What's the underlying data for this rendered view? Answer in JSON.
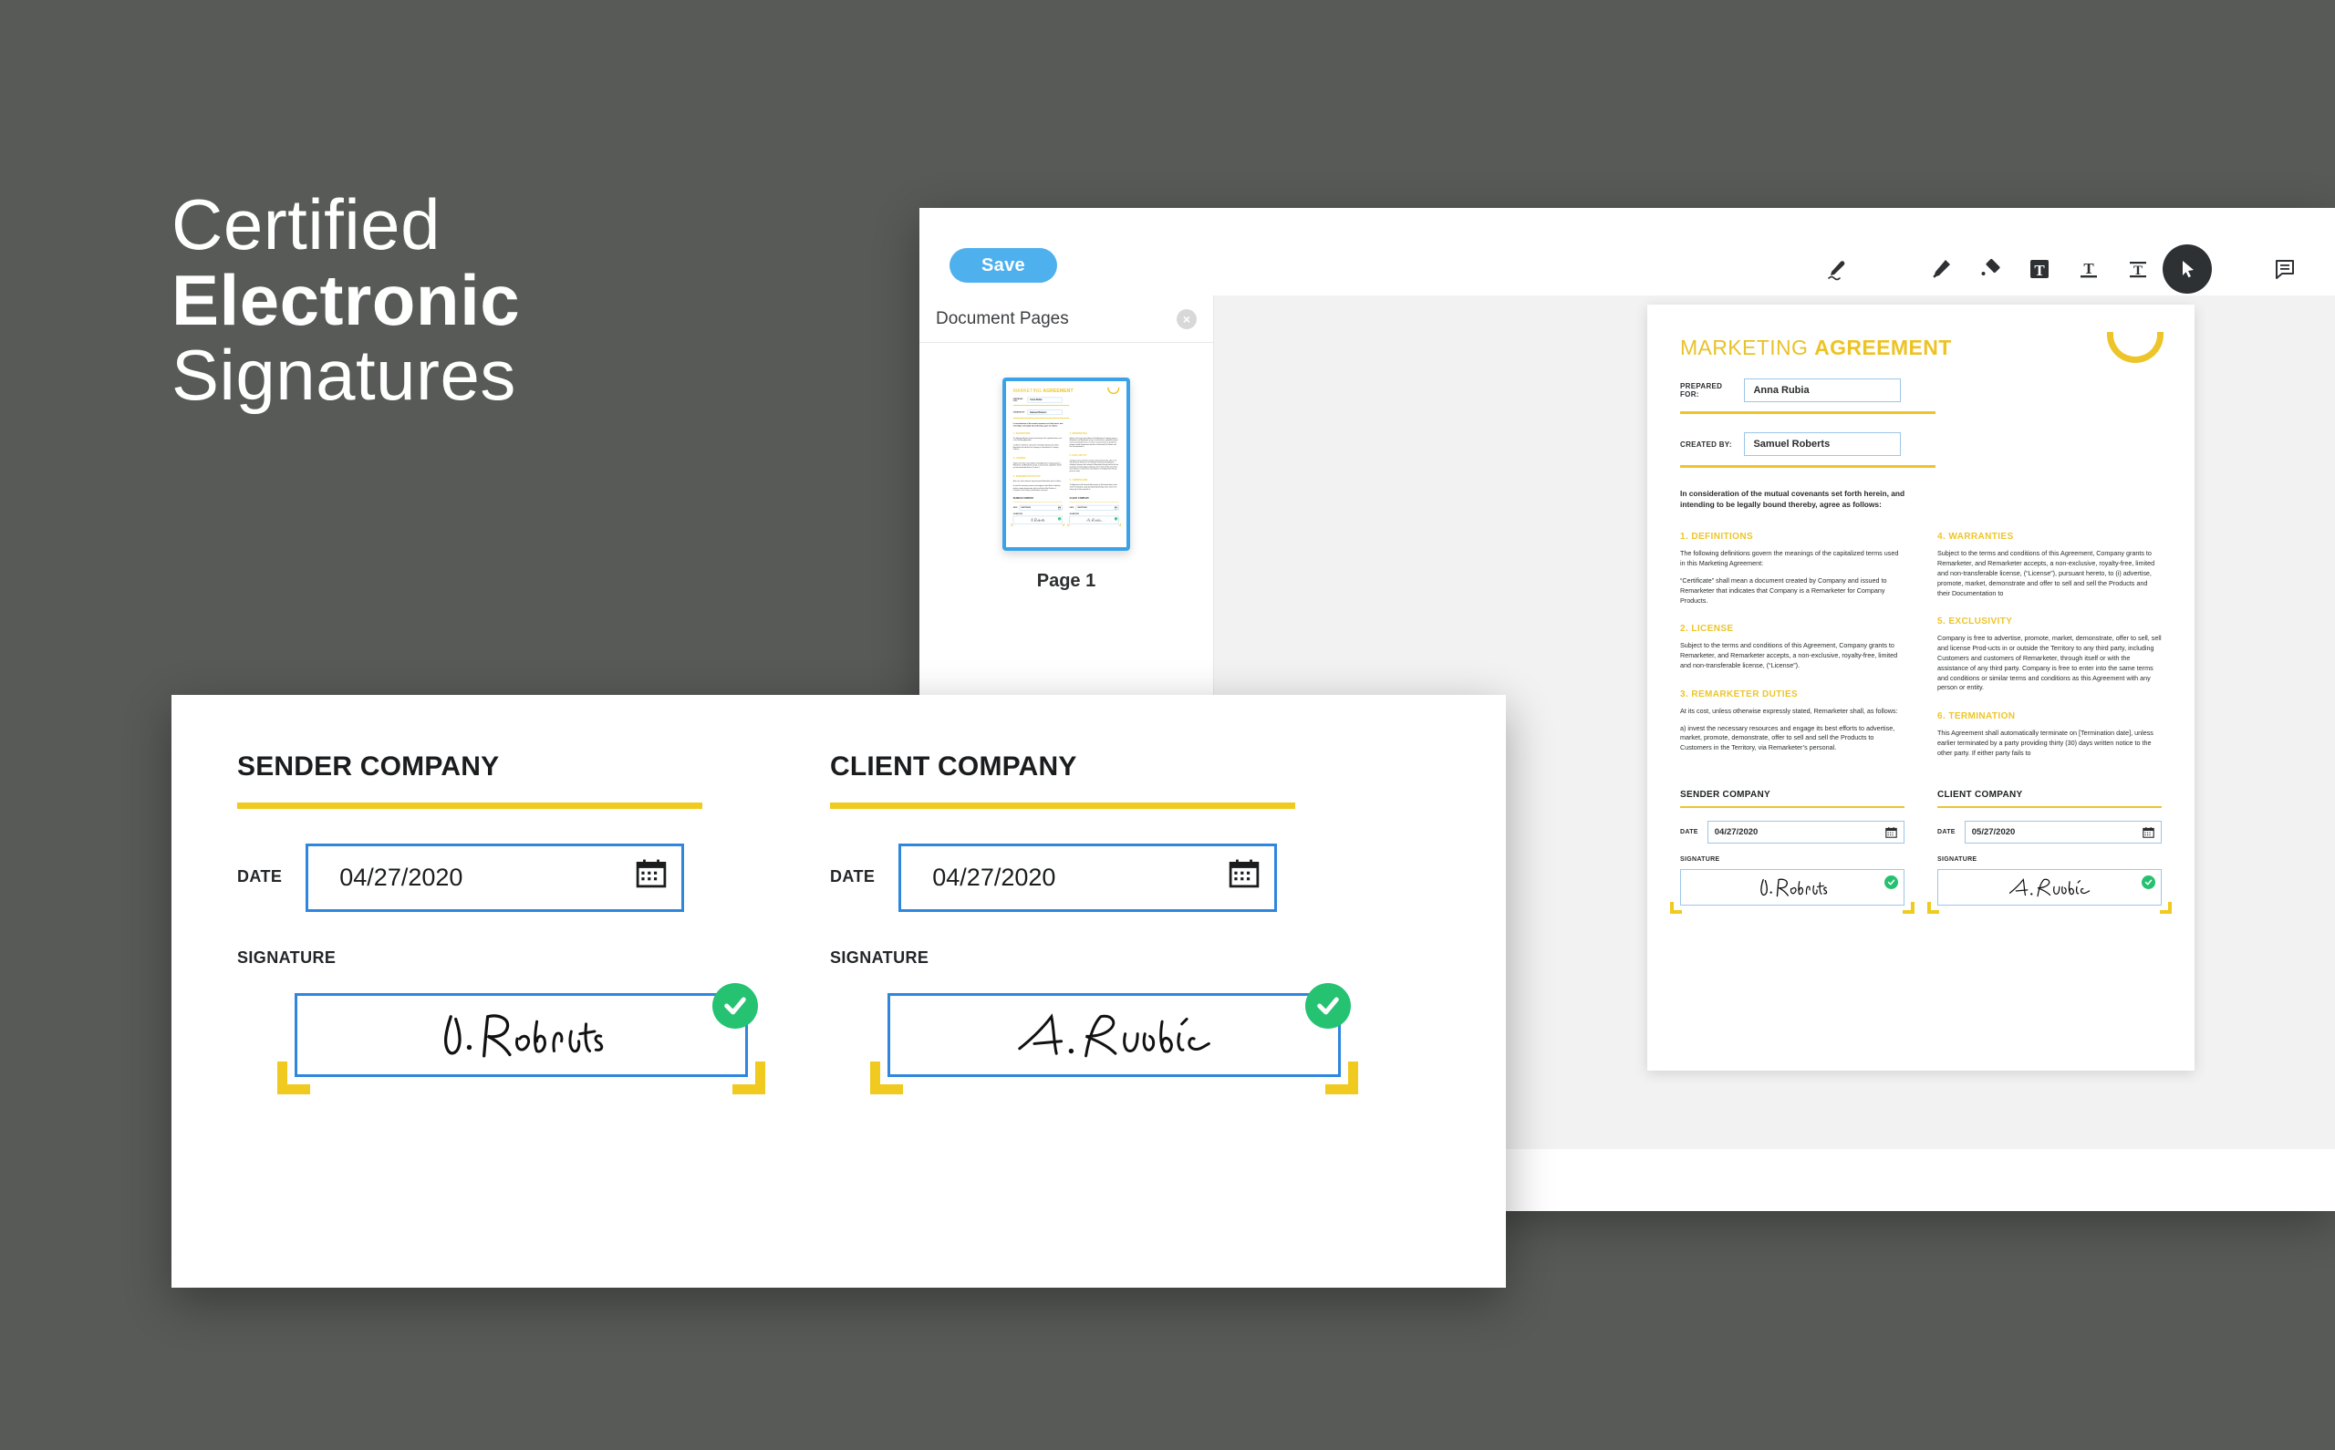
{
  "headline": {
    "line1": "Certified",
    "line2": "Electronic",
    "line3": "Signatures"
  },
  "colors": {
    "background": "#575a57",
    "accent_yellow": "#edc52a",
    "accent_blue": "#2e86de",
    "save_blue": "#4fb0ee",
    "check_green": "#24c271",
    "field_border_blue": "#9cc6e8"
  },
  "toolbar": {
    "save_label": "Save",
    "tools": [
      {
        "name": "signature-pen-icon",
        "label": "Signature",
        "active": false
      },
      {
        "name": "highlighter-icon",
        "label": "Highlight",
        "active": false
      },
      {
        "name": "eraser-icon",
        "label": "Erase",
        "active": false
      },
      {
        "name": "text-box-icon",
        "label": "Text Box",
        "active": false
      },
      {
        "name": "text-underline-icon",
        "label": "Underline Text",
        "active": false
      },
      {
        "name": "text-strikethrough-icon",
        "label": "Strikethrough Text",
        "active": false
      },
      {
        "name": "select-cursor-icon",
        "label": "Select",
        "active": true
      },
      {
        "name": "comment-icon",
        "label": "Comment",
        "active": false
      }
    ]
  },
  "sidebar": {
    "title": "Document Pages",
    "close_label": "×",
    "pages": [
      {
        "label": "Page 1",
        "selected": true
      }
    ]
  },
  "document": {
    "title_light": "MARKETING ",
    "title_bold": "AGREEMENT",
    "fields": [
      {
        "label": "PREPARED FOR:",
        "value": "Anna Rubia"
      },
      {
        "label": "CREATED BY:",
        "value": "Samuel Roberts"
      }
    ],
    "intro": "In consideration of the mutual covenants set forth herein, and intending to be legally bound thereby, agree as follows:",
    "left_sections": [
      {
        "heading": "1. DEFINITIONS",
        "paragraphs": [
          "The following definitions govern the meanings of the capitalized terms used in this Marketing Agreement:",
          "“Certificate” shall mean a document created by Company and issued to Remarketer that indicates that Company is a Remarketer for Company Products."
        ]
      },
      {
        "heading": "2. LICENSE",
        "paragraphs": [
          "Subject to the terms and conditions of this Agreement, Company grants to Remarketer, and Remarketer accepts, a non-exclusive, royalty-free, limited and non-transferable license, (“License”)."
        ]
      },
      {
        "heading": "3. REMARKETER DUTIES",
        "paragraphs": [
          "At its cost, unless otherwise expressly stated, Remarketer shall, as follows:",
          "a) invest the necessary resources and engage its best efforts to advertise, market, promote, demonstrate, offer to sell and sell the Products to Customers in the Territory, via Remarketer’s personal."
        ]
      }
    ],
    "right_sections": [
      {
        "heading": "4. WARRANTIES",
        "paragraphs": [
          "Subject to the terms and conditions of this Agreement, Company grants to Remarketer, and Remarketer accepts, a non-exclusive, royalty-free, limited and non-transferable license, (“License”), pursuant hereto, to (i) advertise, promote, market, demonstrate and offer to sell and sell the Products and their Documentation to"
        ]
      },
      {
        "heading": "5. EXCLUSIVITY",
        "paragraphs": [
          "Company is free to advertise, promote, market, demonstrate, offer to sell, sell and license Prod-ucts in or outside the Territory to any third party, including Customers and customers of Remarketer, through itself or with the assistance of any third party. Company is free to enter into the same terms and conditions or similar terms and conditions as this Agreement with any person or entity."
        ]
      },
      {
        "heading": "6. TERMINATION",
        "paragraphs": [
          "This Agreement shall automatically terminate on [Termination date], unless earlier terminated by a party providing thirty (30) days written notice to the other party. If either party fails to"
        ]
      }
    ],
    "signature_blocks": [
      {
        "company": "SENDER COMPANY",
        "date_label": "DATE",
        "date_value": "04/27/2020",
        "signature_label": "SIGNATURE",
        "signature_name": "J. Roberts",
        "verified": true
      },
      {
        "company": "CLIENT COMPANY",
        "date_label": "DATE",
        "date_value": "05/27/2020",
        "signature_label": "SIGNATURE",
        "signature_name": "A. Rubia",
        "verified": true
      }
    ]
  },
  "foreground_card": {
    "blocks": [
      {
        "company": "SENDER COMPANY",
        "date_label": "DATE",
        "date_value": "04/27/2020",
        "signature_label": "SIGNATURE",
        "signature_name": "J. Roberts",
        "verified": true
      },
      {
        "company": "CLIENT COMPANY",
        "date_label": "DATE",
        "date_value": "04/27/2020",
        "signature_label": "SIGNATURE",
        "signature_name": "A. Rubia",
        "verified": true
      }
    ]
  }
}
